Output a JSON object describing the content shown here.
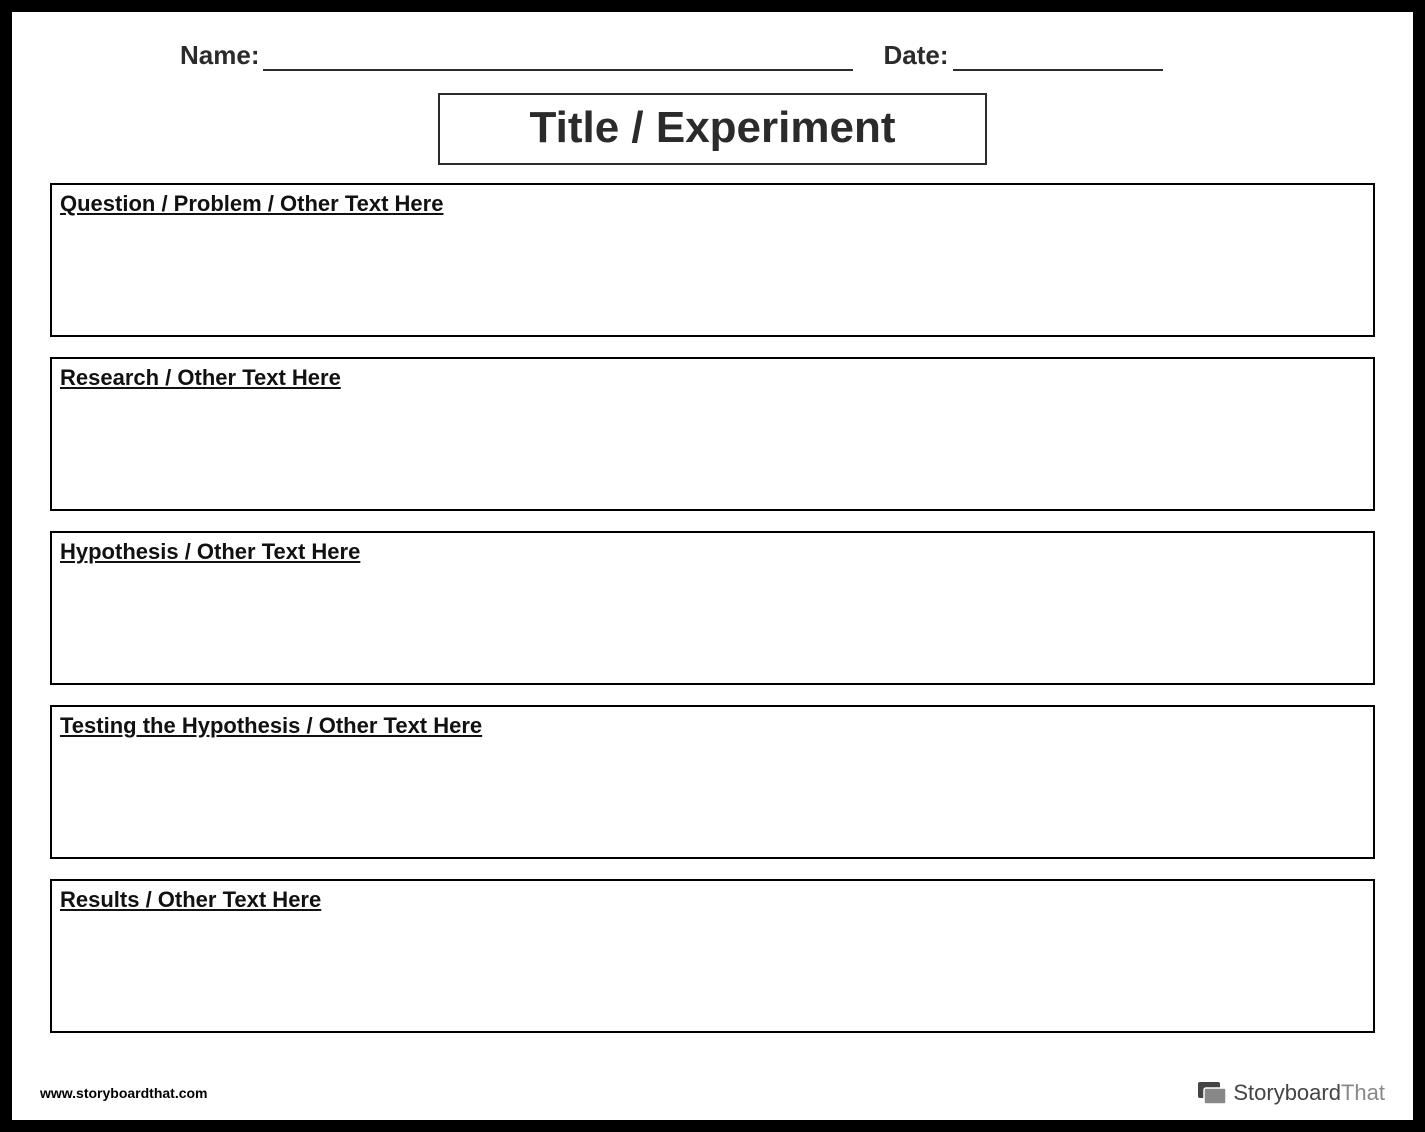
{
  "header": {
    "name_label": "Name:",
    "date_label": "Date:"
  },
  "title": "Title / Experiment",
  "sections": [
    "Question / Problem / Other Text Here",
    "Research / Other Text Here",
    "Hypothesis / Other Text Here",
    "Testing the Hypothesis / Other Text Here",
    "Results / Other Text Here"
  ],
  "footer": {
    "url": "www.storyboardthat.com",
    "brand_strong": "Storyboard",
    "brand_light": "That"
  }
}
